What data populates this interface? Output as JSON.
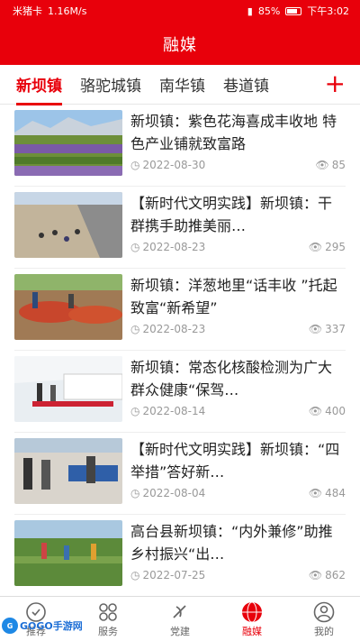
{
  "status_bar": {
    "carrier": "米猪卡",
    "speed": "1.16M/s",
    "battery": "85%",
    "time": "下午3:02"
  },
  "header": {
    "title": "融媒"
  },
  "tabs": [
    "新坝镇",
    "骆驼城镇",
    "南华镇",
    "巷道镇"
  ],
  "add_tab_label": "+",
  "articles": [
    {
      "title": "新坝镇：紫色花海喜成丰收地  特色产业铺就致富路",
      "date": "2022-08-30",
      "views": "85"
    },
    {
      "title": "【新时代文明实践】新坝镇：干群携手助推美丽…",
      "date": "2022-08-23",
      "views": "295"
    },
    {
      "title": "新坝镇：洋葱地里“话丰收 ”托起致富“新希望”",
      "date": "2022-08-23",
      "views": "337"
    },
    {
      "title": "新坝镇：常态化核酸检测为广大群众健康“保驾…",
      "date": "2022-08-14",
      "views": "400"
    },
    {
      "title": "【新时代文明实践】新坝镇：“四举措”答好新…",
      "date": "2022-08-04",
      "views": "484"
    },
    {
      "title": "高台县新坝镇：“内外兼修”助推乡村振兴“出…",
      "date": "2022-07-25",
      "views": "862"
    }
  ],
  "bottom_nav": [
    {
      "label": "推荐",
      "icon": "recommend-icon"
    },
    {
      "label": "服务",
      "icon": "grid-icon"
    },
    {
      "label": "党建",
      "icon": "party-icon"
    },
    {
      "label": "融媒",
      "icon": "news-globe-icon"
    },
    {
      "label": "我的",
      "icon": "user-icon"
    }
  ],
  "watermark": "GOGO手游网",
  "colors": {
    "brand": "#e8000b"
  }
}
